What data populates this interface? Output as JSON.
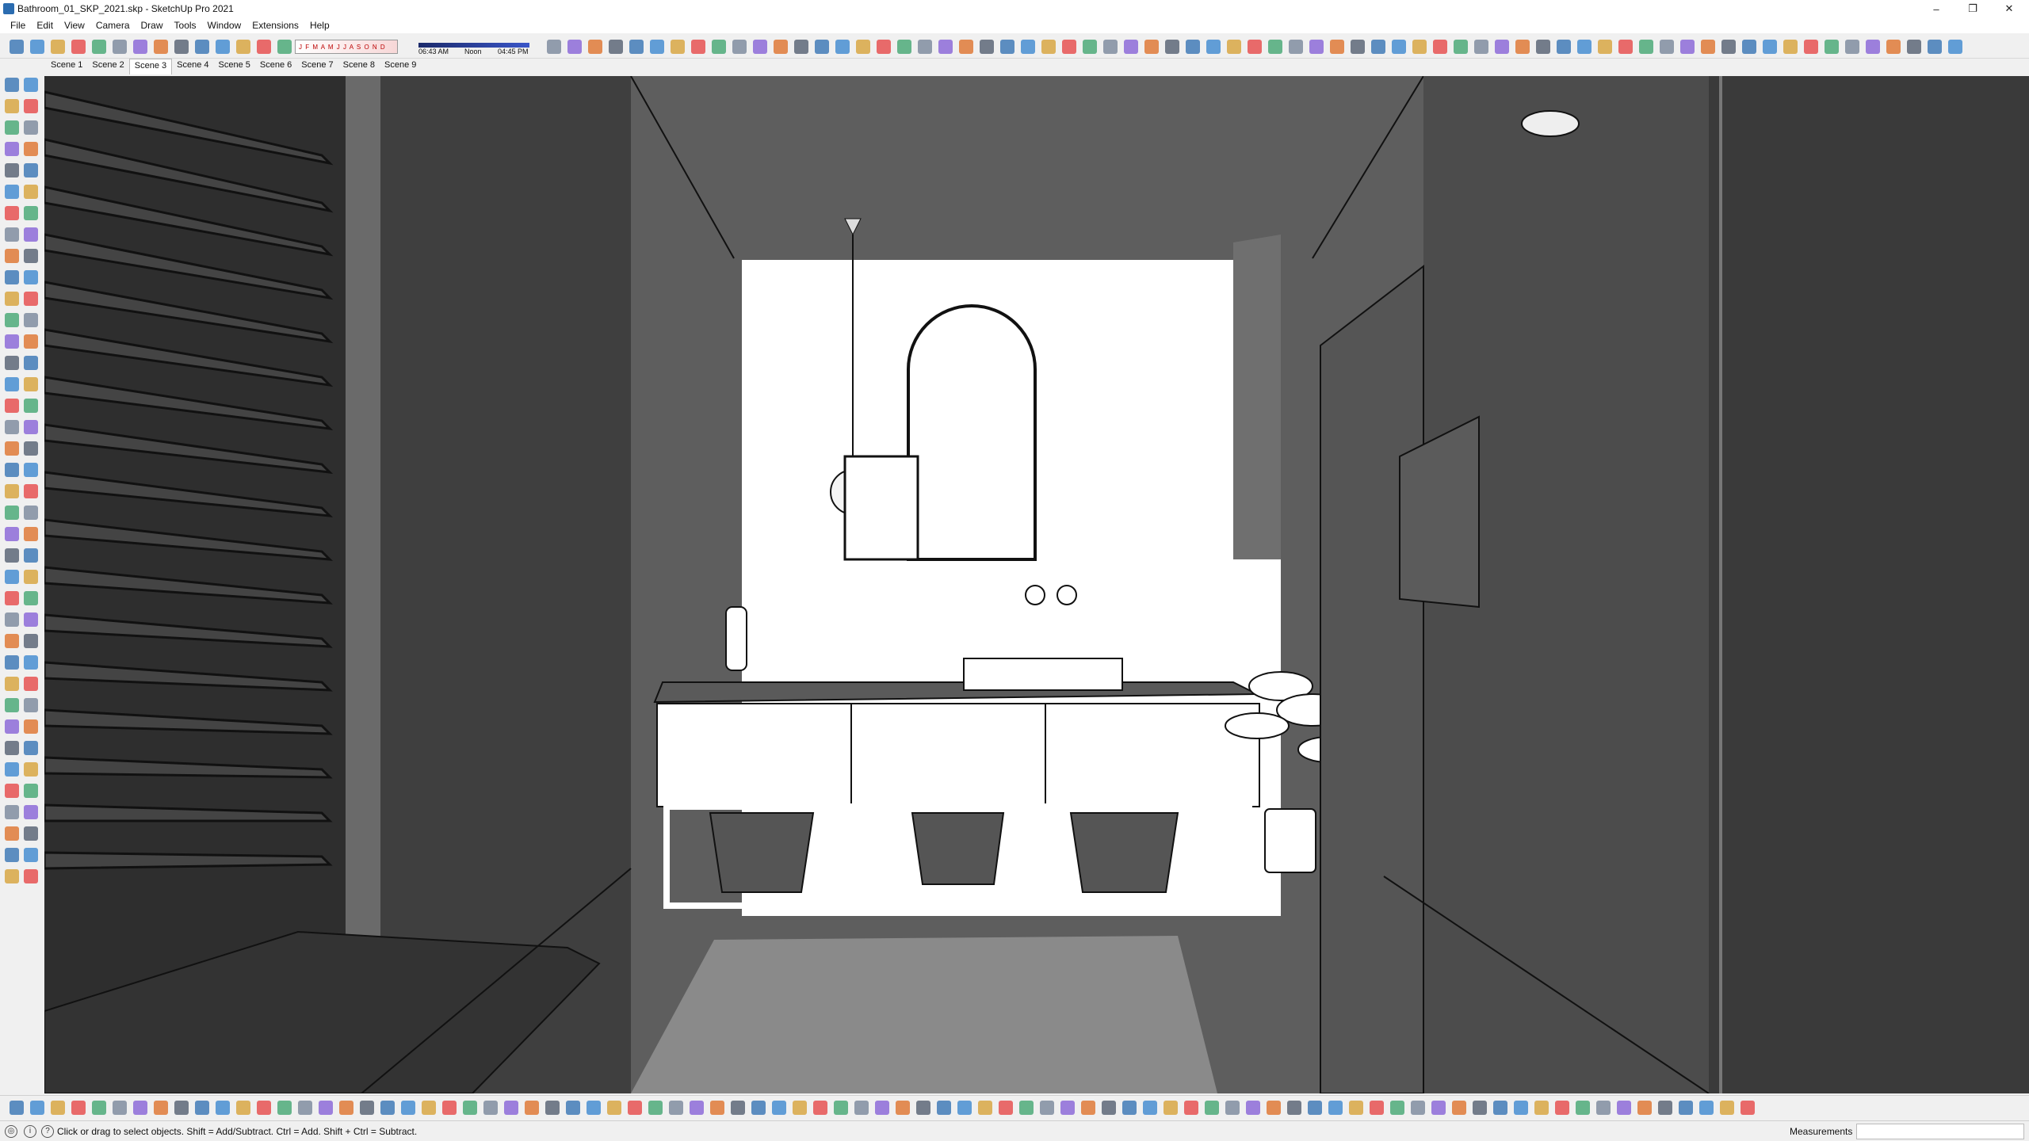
{
  "window": {
    "title": "Bathroom_01_SKP_2021.skp - SketchUp Pro 2021",
    "minimize": "–",
    "maximize": "❐",
    "close": "✕"
  },
  "menu": [
    "File",
    "Edit",
    "View",
    "Camera",
    "Draw",
    "Tools",
    "Window",
    "Extensions",
    "Help"
  ],
  "shadow_settings": {
    "months": "J F M A M J J A S O N D",
    "time_start": "06:43 AM",
    "time_noon": "Noon",
    "time_end": "04:45 PM"
  },
  "scenes": [
    "Scene 1",
    "Scene 2",
    "Scene 3",
    "Scene 4",
    "Scene 5",
    "Scene 6",
    "Scene 7",
    "Scene 8",
    "Scene 9"
  ],
  "active_scene": "Scene 3",
  "status": {
    "hint": "Click or drag to select objects. Shift = Add/Subtract. Ctrl = Add. Shift + Ctrl = Subtract.",
    "measurements_label": "Measurements",
    "measurements_value": ""
  },
  "colors": {
    "viewport_bg": "#5e5e5e",
    "accent": "#2b6cb0"
  }
}
